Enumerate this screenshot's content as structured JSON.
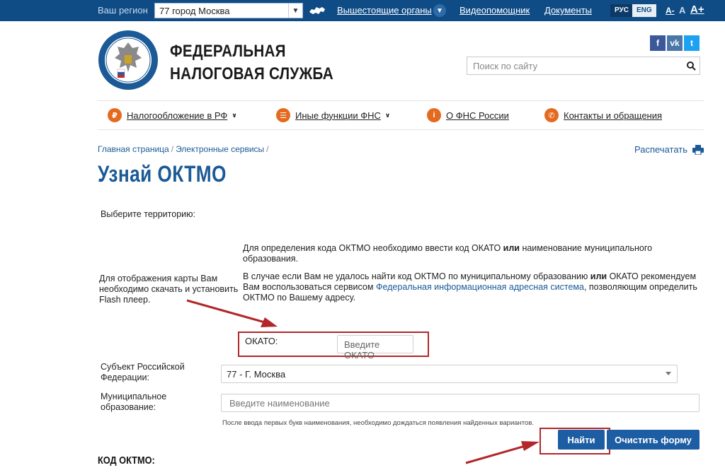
{
  "topbar": {
    "region_label": "Ваш регион",
    "region_value": "77 город Москва",
    "links": [
      "Вышестоящие органы",
      "Видеопомощник",
      "Документы"
    ],
    "lang_ru": "РУС",
    "lang_en": "ENG",
    "font_sizes": [
      "A-",
      "A",
      "A+"
    ]
  },
  "header": {
    "brand_line1": "ФЕДЕРАЛЬНАЯ",
    "brand_line2": "НАЛОГОВАЯ СЛУЖБА",
    "search_placeholder": "Поиск по сайту",
    "social": [
      "f",
      "vk",
      "t"
    ]
  },
  "nav": {
    "items": [
      {
        "label": "Налогообложение в РФ",
        "icon": "rub-icon"
      },
      {
        "label": "Иные функции ФНС",
        "icon": "menu-icon"
      },
      {
        "label": "О ФНС России",
        "icon": "info-icon"
      },
      {
        "label": "Контакты и обращения",
        "icon": "phone-icon"
      }
    ]
  },
  "breadcrumb": {
    "items": [
      "Главная страница",
      "Электронные сервисы"
    ],
    "separator": "/"
  },
  "print_label": "Распечатать",
  "page_title": "Узнай ОКТМО",
  "content": {
    "choose_territory": "Выберите территорию:",
    "flash_notice_1": "Для отображения карты Вам",
    "flash_notice_2": "необходимо скачать и установить",
    "flash_notice_3": "Flash плеер.",
    "info1_a": "Для определения кода ОКТМО необходимо ввести код ОКАТО ",
    "info1_bold": "или",
    "info1_b": " наименование муниципального",
    "info1_c": "образования.",
    "info2_a": "В случае если Вам не удалось найти код ОКТМО по муниципальному образованию ",
    "info2_bold": "или",
    "info2_b": " ОКАТО рекомендуем",
    "info2_c": "Вам воспользоваться сервисом ",
    "info2_link": "Федеральная информационная адресная система",
    "info2_d": ", позволяющим определить",
    "info2_e": "ОКТМО по Вашему адресу."
  },
  "form": {
    "okato_label": "ОКАТО:",
    "okato_placeholder": "Введите ОКАТО",
    "subject_label_1": "Субъект Российской",
    "subject_label_2": "Федерации:",
    "subject_value": "77 - Г. Москва",
    "municipal_label_1": "Муниципальное",
    "municipal_label_2": "образование:",
    "municipal_placeholder": "Введите наименование",
    "hint": "После ввода первых букв наименования, необходимо дождаться появления найденных вариантов.",
    "find_button": "Найти",
    "clear_button": "Очистить форму"
  },
  "result_label": "КОД ОКТМО:",
  "annotation_color": "#b3262b",
  "accent_color": "#0f4c86"
}
